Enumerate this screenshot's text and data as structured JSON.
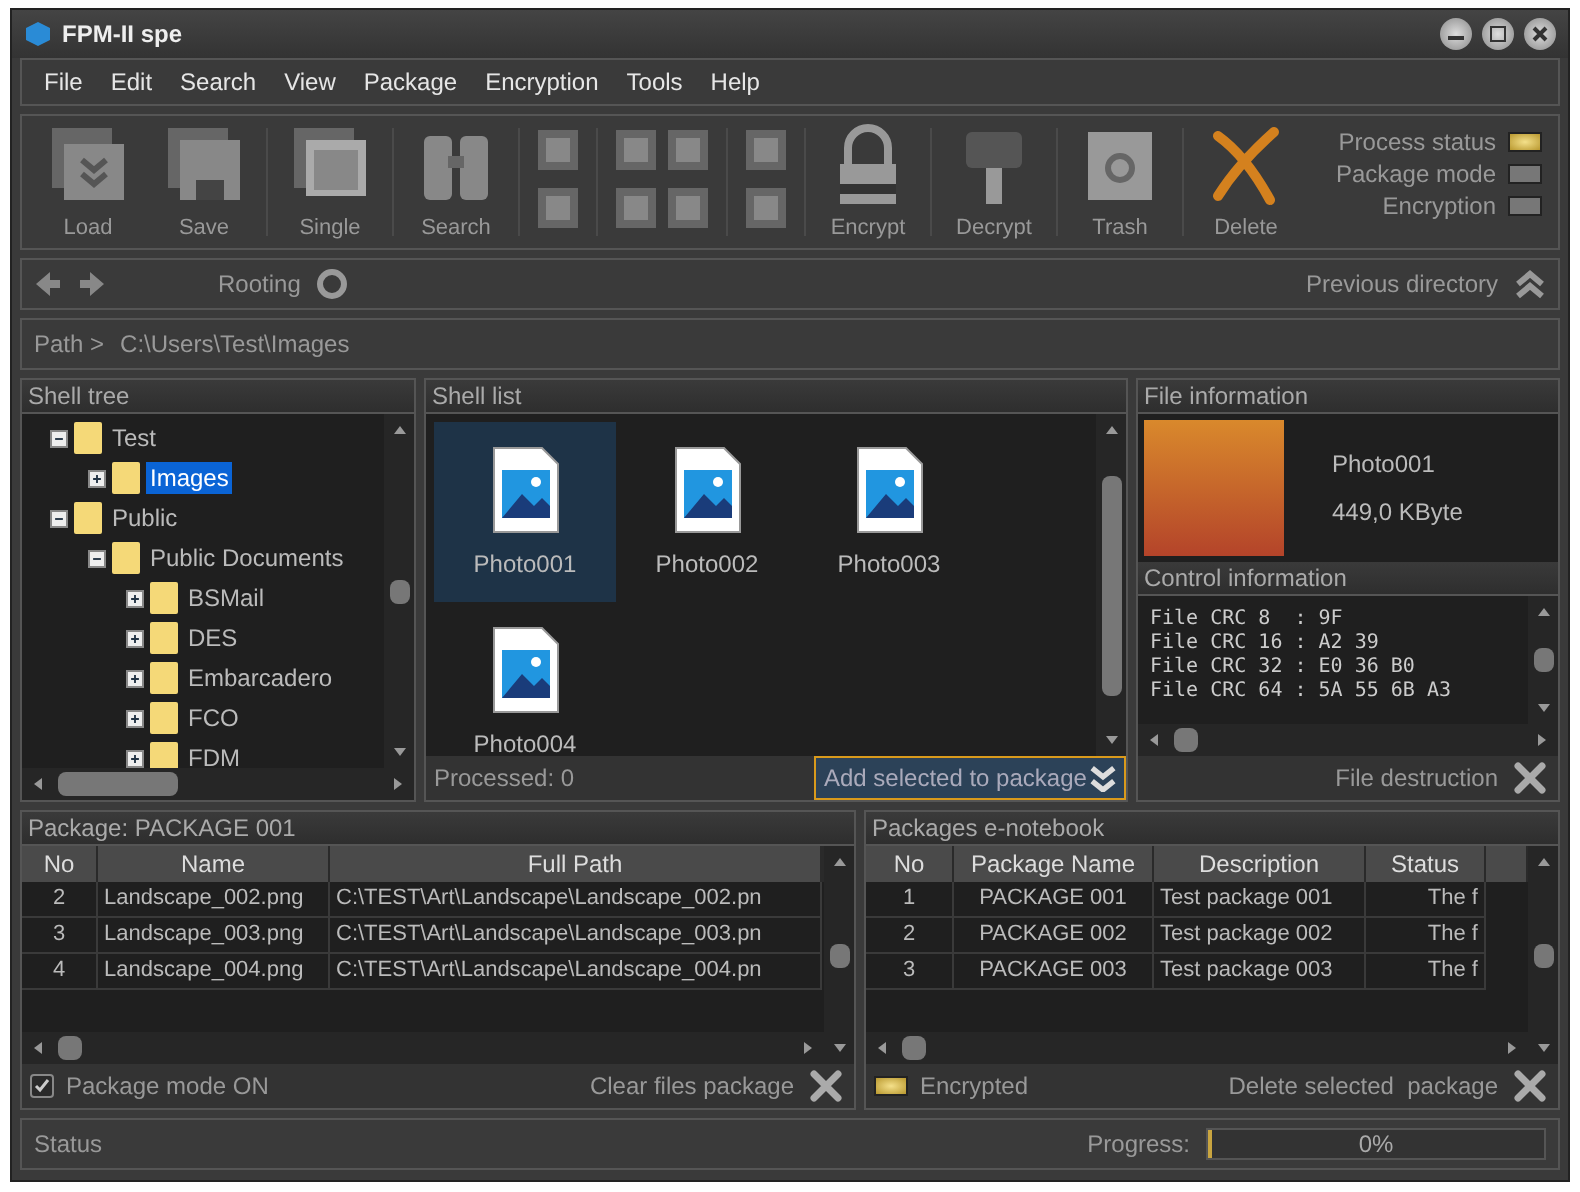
{
  "window": {
    "title": "FPM-II spe"
  },
  "menu": [
    "File",
    "Edit",
    "Search",
    "View",
    "Package",
    "Encryption",
    "Tools",
    "Help"
  ],
  "toolbar": {
    "buttons": [
      "Load",
      "Save",
      "Single",
      "Search",
      "Encrypt",
      "Decrypt",
      "Trash",
      "Delete"
    ]
  },
  "indicators": [
    {
      "label": "Process status",
      "on": true
    },
    {
      "label": "Package mode",
      "on": false
    },
    {
      "label": "Encryption",
      "on": false
    }
  ],
  "nav": {
    "rooting": "Rooting",
    "previous_directory": "Previous directory"
  },
  "path": {
    "label": "Path >",
    "value": "C:\\Users\\Test\\Images"
  },
  "shell_tree": {
    "title": "Shell tree",
    "items": [
      {
        "label": "Test",
        "expanded": true,
        "selected": false,
        "children": [
          {
            "label": "Images",
            "expanded": false,
            "selected": true
          }
        ]
      },
      {
        "label": "Public",
        "expanded": true,
        "selected": false,
        "children": [
          {
            "label": "Public Documents",
            "expanded": true,
            "selected": false,
            "children": [
              {
                "label": "BSMail",
                "expanded": false,
                "selected": false
              },
              {
                "label": "DES",
                "expanded": false,
                "selected": false
              },
              {
                "label": "Embarcadero",
                "expanded": false,
                "selected": false
              },
              {
                "label": "FCO",
                "expanded": false,
                "selected": false
              },
              {
                "label": "FDM",
                "expanded": false,
                "selected": false
              }
            ]
          }
        ]
      }
    ]
  },
  "shell_list": {
    "title": "Shell list",
    "items": [
      {
        "name": "Photo001",
        "selected": true
      },
      {
        "name": "Photo002",
        "selected": false
      },
      {
        "name": "Photo003",
        "selected": false
      },
      {
        "name": "Photo004",
        "selected": false
      }
    ],
    "processed": "Processed: 0",
    "add_button": "Add selected to package"
  },
  "file_information": {
    "title": "File information",
    "name": "Photo001",
    "size": "449,0 KByte"
  },
  "control_information": {
    "title": "Control information",
    "lines": [
      "File CRC 8  : 9F",
      "File CRC 16 : A2 39",
      "File CRC 32 : E0 36 B0",
      "File CRC 64 : 5A 55 6B A3"
    ],
    "action": "File destruction"
  },
  "package": {
    "title": "Package: PACKAGE 001",
    "columns": [
      "No",
      "Name",
      "Full Path"
    ],
    "rows": [
      [
        "2",
        "Landscape_002.png",
        "C:\\TEST\\Art\\Landscape\\Landscape_002.pn"
      ],
      [
        "3",
        "Landscape_003.png",
        "C:\\TEST\\Art\\Landscape\\Landscape_003.pn"
      ],
      [
        "4",
        "Landscape_004.png",
        "C:\\TEST\\Art\\Landscape\\Landscape_004.pn"
      ]
    ],
    "mode": {
      "label": "Package mode ON",
      "checked": true
    },
    "action": "Clear files package"
  },
  "notebook": {
    "title": "Packages e-notebook",
    "columns": [
      "No",
      "Package Name",
      "Description",
      "Status"
    ],
    "rows": [
      [
        "1",
        "PACKAGE 001",
        "Test package 001",
        "The f"
      ],
      [
        "2",
        "PACKAGE 002",
        "Test package 002",
        "The f"
      ],
      [
        "3",
        "PACKAGE 003",
        "Test package 003",
        "The f"
      ]
    ],
    "encrypted": {
      "label": "Encrypted",
      "on": true
    },
    "action": "Delete selected  package"
  },
  "status_bar": {
    "status": "Status",
    "progress_label": "Progress:",
    "progress": {
      "level": 0,
      "text": "0%"
    }
  }
}
